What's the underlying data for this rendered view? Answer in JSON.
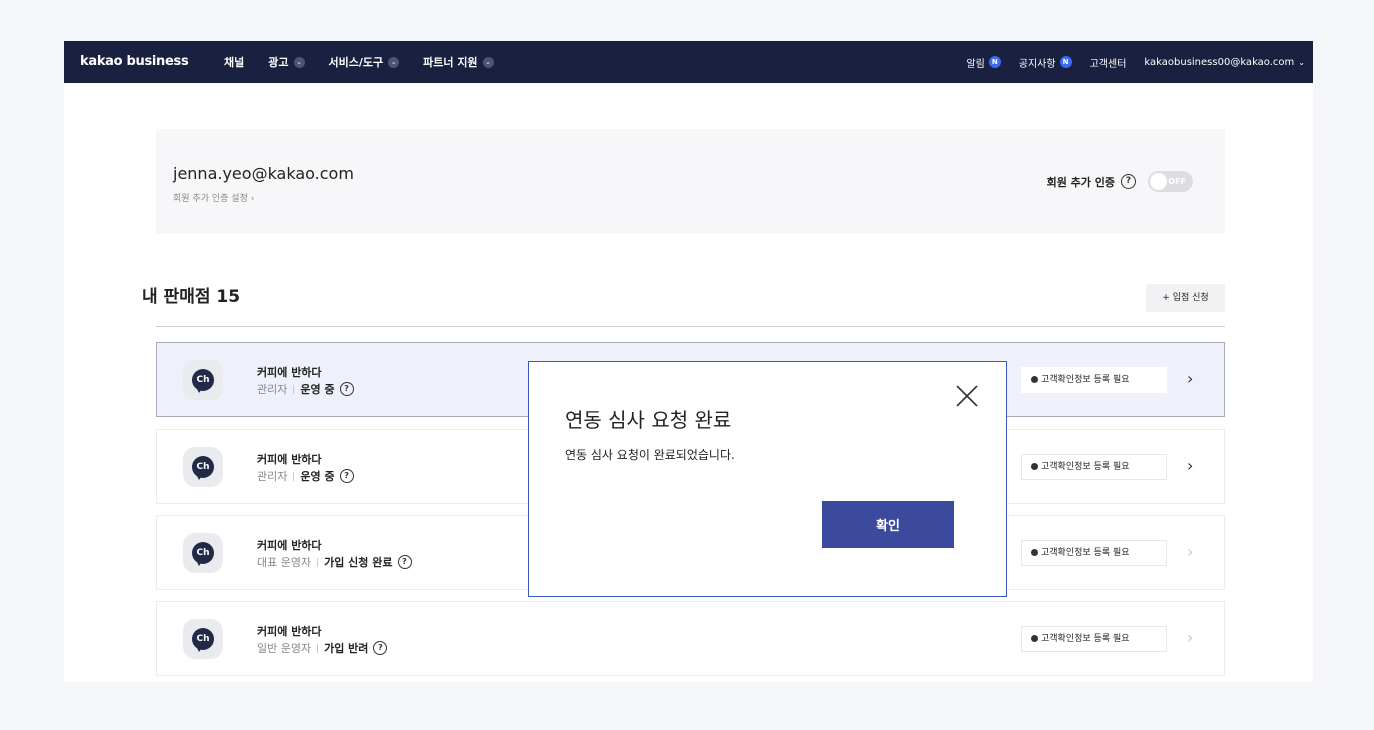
{
  "nav": {
    "logo": "kakao business",
    "menu": [
      {
        "label": "채널",
        "has_dropdown": false
      },
      {
        "label": "광고",
        "has_dropdown": true
      },
      {
        "label": "서비스/도구",
        "has_dropdown": true
      },
      {
        "label": "파트너 지원",
        "has_dropdown": true
      }
    ],
    "notifications_label": "알림",
    "notices_label": "공지사항",
    "new_badge": "N",
    "support_label": "고객센터",
    "account_email": "kakaobusiness00@kakao.com"
  },
  "account": {
    "email": "jenna.yeo@kakao.com",
    "settings_link": "회원 추가 인증 설정",
    "auth_label": "회원 추가 인증",
    "toggle_state": "OFF"
  },
  "stores": {
    "title": "내 판매점 15",
    "apply_button": "+ 입점 신청",
    "rows": [
      {
        "name": "커피에 반하다",
        "role": "관리자",
        "status": "운영 중",
        "warning": "고객확인정보 등록 필요",
        "selected": true,
        "enabled": true
      },
      {
        "name": "커피에 반하다",
        "role": "관리자",
        "status": "운영 중",
        "warning": "고객확인정보 등록 필요",
        "selected": false,
        "enabled": true
      },
      {
        "name": "커피에 반하다",
        "role": "대표 운영자",
        "status": "가입 신청 완료",
        "warning": "고객확인정보 등록 필요",
        "selected": false,
        "enabled": false
      },
      {
        "name": "커피에 반하다",
        "role": "일반 운영자",
        "status": "가입 반려",
        "warning": "고객확인정보 등록 필요",
        "selected": false,
        "enabled": false
      }
    ]
  },
  "modal": {
    "title": "연동 심사 요청 완료",
    "message": "연동 심사 요청이 완료되었습니다.",
    "confirm_label": "확인"
  },
  "icons": {
    "help": "?",
    "avatar": "Ch",
    "arrow": "›",
    "dropdown": "⌄"
  },
  "colors": {
    "nav_bg": "#1a2140",
    "accent": "#3b4a9c",
    "badge": "#3d6cf0"
  }
}
